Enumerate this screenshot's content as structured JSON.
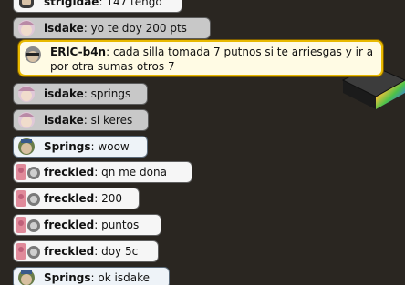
{
  "chat": {
    "messages": [
      {
        "user": "strigidae",
        "text": "147 tengo",
        "style": "white",
        "avatar": "avatar-head-icon"
      },
      {
        "user": "isdake",
        "text": "yo te doy 200 pts",
        "style": "grey",
        "avatar": "avatar-head-icon"
      },
      {
        "user": "ERlC-b4n",
        "text": "cada silla tomada 7 putnos si te arriesgas y ir a por otra sumas otros 7",
        "style": "yellow",
        "avatar": "avatar-head-icon"
      },
      {
        "user": "isdake",
        "text": "springs",
        "style": "grey",
        "avatar": "avatar-head-icon"
      },
      {
        "user": "isdake",
        "text": "si keres",
        "style": "grey",
        "avatar": "avatar-head-icon"
      },
      {
        "user": "Springs",
        "text": "woow",
        "style": "blue",
        "avatar": "avatar-head-icon"
      },
      {
        "user": "freckled",
        "text": "qn me dona",
        "style": "white",
        "avatar": "pig-icon"
      },
      {
        "user": "freckled",
        "text": "200",
        "style": "white",
        "avatar": "pig-icon"
      },
      {
        "user": "freckled",
        "text": "puntos",
        "style": "white",
        "avatar": "pig-icon"
      },
      {
        "user": "freckled",
        "text": "doy 5c",
        "style": "white",
        "avatar": "pig-icon"
      },
      {
        "user": "Springs",
        "text": "ok isdake",
        "style": "blue",
        "avatar": "avatar-head-icon"
      }
    ]
  },
  "colors": {
    "background": "#2a2621",
    "bubble_grey": "#c8c8c8",
    "bubble_white": "#f6f6f6",
    "bubble_yellow_border": "#e8b900",
    "pig_pink": "#e08a9a"
  },
  "scene": {
    "furniture": "rainbow-cube-furniture"
  }
}
